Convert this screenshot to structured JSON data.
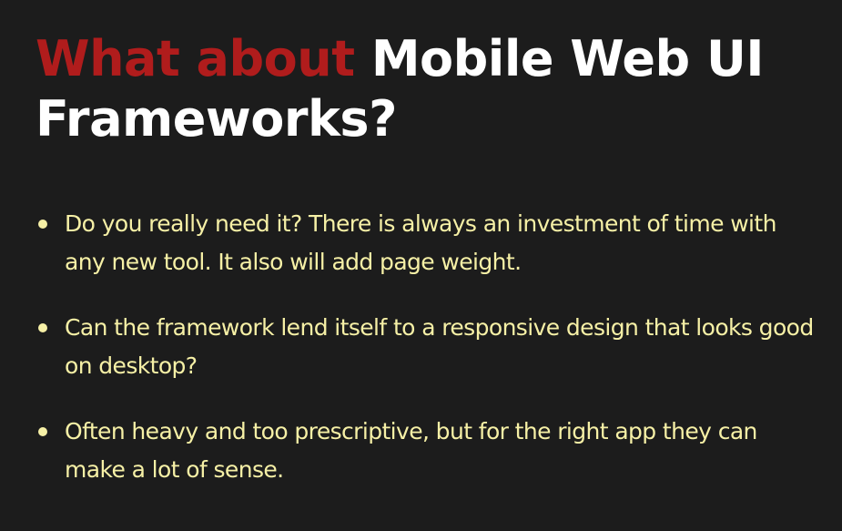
{
  "slide": {
    "title": {
      "accent": "What about",
      "rest": " Mobile Web UI Frameworks?"
    },
    "bullets": [
      {
        "text": "Do you really need it?  There is always an investment of time with any new tool.  It also will add page weight."
      },
      {
        "text": "Can the framework lend itself to a responsive design that looks good on desktop?"
      },
      {
        "text": "Often heavy and too prescriptive, but for the right app they can make a lot of sense."
      }
    ],
    "colors": {
      "background": "#1c1c1c",
      "title": "#ffffff",
      "title_accent": "#b01c1c",
      "body_text": "#f6f0a6"
    }
  }
}
